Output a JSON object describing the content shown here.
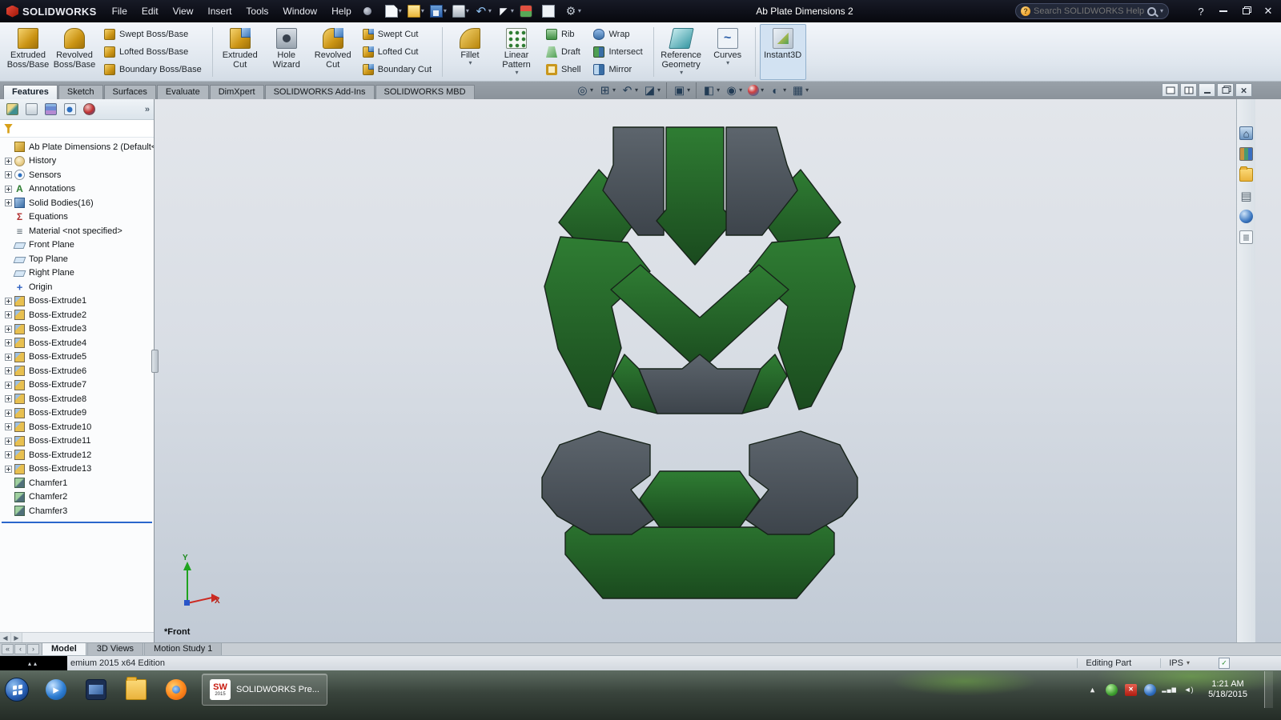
{
  "titlebar": {
    "brand": "SOLIDWORKS",
    "menus": [
      "File",
      "Edit",
      "View",
      "Insert",
      "Tools",
      "Window",
      "Help"
    ],
    "quick_access": [
      {
        "icon": "new-doc",
        "arrow": true
      },
      {
        "icon": "open-folder",
        "arrow": true
      },
      {
        "icon": "save",
        "arrow": true
      },
      {
        "icon": "print",
        "arrow": true
      },
      {
        "icon": "undo",
        "arrow": true
      },
      {
        "icon": "select-cursor",
        "arrow": true
      },
      {
        "icon": "rebuild",
        "arrow": false
      },
      {
        "icon": "file-properties",
        "arrow": false
      },
      {
        "icon": "options",
        "arrow": true
      }
    ],
    "document_title": "Ab Plate Dimensions 2",
    "search_placeholder": "Search SOLIDWORKS Help"
  },
  "ribbon": {
    "groups": [
      {
        "items": [
          {
            "label": "Extruded Boss/Base",
            "icon": "extruded-boss"
          },
          {
            "label": "Revolved Boss/Base",
            "icon": "revolved-boss"
          }
        ]
      },
      {
        "items": [
          {
            "label": "Swept Boss/Base",
            "icon": "swept-boss"
          },
          {
            "label": "Lofted Boss/Base",
            "icon": "lofted-boss"
          },
          {
            "label": "Boundary Boss/Base",
            "icon": "boundary-boss"
          }
        ]
      },
      {
        "items": [
          {
            "label": "Extruded Cut",
            "icon": "extruded-cut"
          },
          {
            "label": "Hole Wizard",
            "icon": "hole-wizard"
          },
          {
            "label": "Revolved Cut",
            "icon": "revolved-cut"
          }
        ]
      },
      {
        "items": [
          {
            "label": "Swept Cut",
            "icon": "swept-cut"
          },
          {
            "label": "Lofted Cut",
            "icon": "lofted-cut"
          },
          {
            "label": "Boundary Cut",
            "icon": "boundary-cut"
          }
        ]
      },
      {
        "items": [
          {
            "label": "Fillet",
            "icon": "fillet",
            "arrow": true
          },
          {
            "label": "Linear Pattern",
            "icon": "linear-pattern",
            "arrow": true
          }
        ]
      },
      {
        "items": [
          {
            "label": "Rib",
            "icon": "rib"
          },
          {
            "label": "Draft",
            "icon": "draft"
          },
          {
            "label": "Shell",
            "icon": "shell"
          }
        ]
      },
      {
        "items": [
          {
            "label": "Wrap",
            "icon": "wrap"
          },
          {
            "label": "Intersect",
            "icon": "intersect"
          },
          {
            "label": "Mirror",
            "icon": "mirror"
          }
        ]
      },
      {
        "items": [
          {
            "label": "Reference Geometry",
            "icon": "reference-geometry",
            "arrow": true
          },
          {
            "label": "Curves",
            "icon": "curves",
            "arrow": true
          }
        ]
      },
      {
        "items": [
          {
            "label": "Instant3D",
            "icon": "instant3d",
            "active": true
          }
        ]
      }
    ]
  },
  "command_tabs": [
    {
      "label": "Features",
      "active": true
    },
    {
      "label": "Sketch"
    },
    {
      "label": "Surfaces"
    },
    {
      "label": "Evaluate"
    },
    {
      "label": "DimXpert"
    },
    {
      "label": "SOLIDWORKS Add-Ins"
    },
    {
      "label": "SOLIDWORKS MBD"
    }
  ],
  "viewport_toolbar": [
    {
      "icon": "zoom-fit"
    },
    {
      "icon": "zoom-area"
    },
    {
      "icon": "previous-view"
    },
    {
      "icon": "section-view",
      "arrow": true
    },
    {
      "icon": "view-orientation",
      "arrow": true,
      "sep": true
    },
    {
      "icon": "display-style",
      "arrow": true,
      "sep": true
    },
    {
      "icon": "hide-show-items",
      "arrow": true
    },
    {
      "icon": "edit-appearance",
      "arrow": true
    },
    {
      "icon": "apply-scene",
      "arrow": true
    },
    {
      "icon": "view-settings",
      "arrow": true
    }
  ],
  "doc_window_buttons": [
    "new-window",
    "tile-windows",
    "minimize",
    "restore",
    "close"
  ],
  "panel_tabs": [
    "featuremanager",
    "propertymanager",
    "configurationmanager",
    "dimxpertmanager",
    "displaymanager"
  ],
  "panel_more_label": "»",
  "feature_tree": {
    "root_label": "Ab Plate Dimensions 2  (Default<",
    "items": [
      {
        "label": "History",
        "icon": "history",
        "expander": true
      },
      {
        "label": "Sensors",
        "icon": "sensors",
        "expander": true
      },
      {
        "label": "Annotations",
        "icon": "annotations",
        "expander": true
      },
      {
        "label": "Solid Bodies(16)",
        "icon": "solid-bodies",
        "expander": true
      },
      {
        "label": "Equations",
        "icon": "equations",
        "expander": false
      },
      {
        "label": "Material <not specified>",
        "icon": "material",
        "expander": false
      },
      {
        "label": "Front Plane",
        "icon": "plane",
        "expander": false
      },
      {
        "label": "Top Plane",
        "icon": "plane",
        "expander": false
      },
      {
        "label": "Right Plane",
        "icon": "plane",
        "expander": false
      },
      {
        "label": "Origin",
        "icon": "origin",
        "expander": false
      },
      {
        "label": "Boss-Extrude1",
        "icon": "boss-extrude",
        "expander": true
      },
      {
        "label": "Boss-Extrude2",
        "icon": "boss-extrude",
        "expander": true
      },
      {
        "label": "Boss-Extrude3",
        "icon": "boss-extrude",
        "expander": true
      },
      {
        "label": "Boss-Extrude4",
        "icon": "boss-extrude",
        "expander": true
      },
      {
        "label": "Boss-Extrude5",
        "icon": "boss-extrude",
        "expander": true
      },
      {
        "label": "Boss-Extrude6",
        "icon": "boss-extrude",
        "expander": true
      },
      {
        "label": "Boss-Extrude7",
        "icon": "boss-extrude",
        "expander": true
      },
      {
        "label": "Boss-Extrude8",
        "icon": "boss-extrude",
        "expander": true
      },
      {
        "label": "Boss-Extrude9",
        "icon": "boss-extrude",
        "expander": true
      },
      {
        "label": "Boss-Extrude10",
        "icon": "boss-extrude",
        "expander": true
      },
      {
        "label": "Boss-Extrude11",
        "icon": "boss-extrude",
        "expander": true
      },
      {
        "label": "Boss-Extrude12",
        "icon": "boss-extrude",
        "expander": true
      },
      {
        "label": "Boss-Extrude13",
        "icon": "boss-extrude",
        "expander": true
      },
      {
        "label": "Chamfer1",
        "icon": "chamfer",
        "expander": false
      },
      {
        "label": "Chamfer2",
        "icon": "chamfer",
        "expander": false
      },
      {
        "label": "Chamfer3",
        "icon": "chamfer",
        "expander": false
      }
    ]
  },
  "task_pane_icons": [
    "resources-home",
    "design-library",
    "file-explorer",
    "view-palette",
    "appearances",
    "custom-properties"
  ],
  "viewport": {
    "view_label": "*Front",
    "axis_x": "X",
    "axis_y": "Y"
  },
  "motion_nav": [
    "«",
    "‹",
    "›"
  ],
  "motion_tabs": [
    {
      "label": "Model",
      "active": true
    },
    {
      "label": "3D Views"
    },
    {
      "label": "Motion Study 1"
    }
  ],
  "status_bar": {
    "product_text": "emium 2015 x64 Edition",
    "state_text": "Editing Part",
    "units_text": "IPS"
  },
  "taskbar": {
    "pinned": [
      "media-player",
      "computer",
      "explorer-folder",
      "firefox"
    ],
    "app_button": {
      "label": "SOLIDWORKS Pre...",
      "icon_text": "SW",
      "icon_year": "2015"
    },
    "tray_icons": [
      "hidden-icons",
      "sync-green",
      "alert-red",
      "update-blue",
      "network",
      "volume"
    ],
    "clock": {
      "time": "1:21 AM",
      "date": "5/18/2015"
    }
  },
  "model_colors": {
    "green_top": "#2f7d33",
    "green_bottom": "#1a4a1e",
    "gray_top": "#5d656d",
    "gray_bottom": "#3d444b"
  }
}
